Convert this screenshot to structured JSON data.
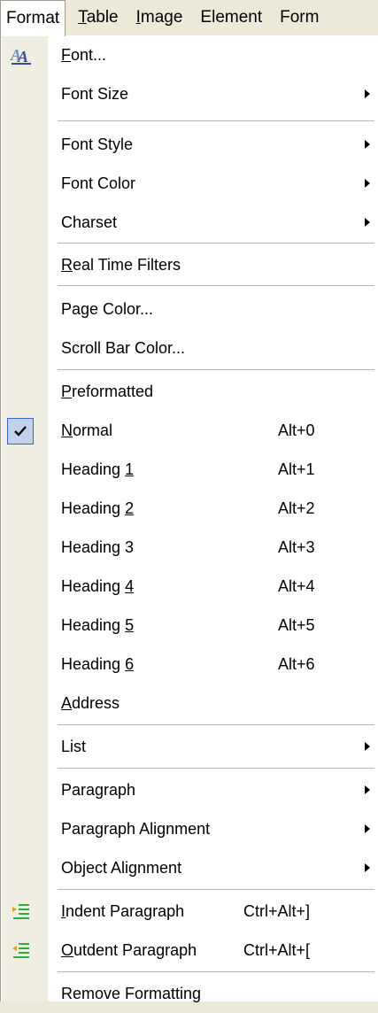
{
  "menubar": {
    "items": [
      {
        "label": "Format",
        "ul": ""
      },
      {
        "label": "able",
        "ul": "T"
      },
      {
        "label": "mage",
        "ul": "I"
      },
      {
        "label": "Element",
        "ul": ""
      },
      {
        "label": "Form",
        "ul": ""
      }
    ]
  },
  "menu": {
    "font": {
      "ul": "F",
      "rest": "ont..."
    },
    "font_size": "Font Size",
    "font_style": "Font Style",
    "font_color": "Font Color",
    "charset": "Charset",
    "real_time_filters": {
      "ul": "R",
      "rest": "eal Time Filters"
    },
    "page_color": "Page Color...",
    "scroll_bar_color": "Scroll Bar Color...",
    "preformatted": {
      "ul": "P",
      "rest": "reformatted"
    },
    "normal": {
      "ul": "N",
      "rest": "ormal",
      "shortcut": "Alt+0"
    },
    "heading1": {
      "pre": "Heading ",
      "ul": "1",
      "shortcut": "Alt+1"
    },
    "heading2": {
      "pre": "Heading ",
      "ul": "2",
      "shortcut": "Alt+2"
    },
    "heading3": {
      "label": "Heading 3",
      "shortcut": "Alt+3"
    },
    "heading4": {
      "pre": "Heading ",
      "ul": "4",
      "shortcut": "Alt+4"
    },
    "heading5": {
      "pre": "Heading ",
      "ul": "5",
      "shortcut": "Alt+5"
    },
    "heading6": {
      "pre": "Heading ",
      "ul": "6",
      "shortcut": "Alt+6"
    },
    "address": {
      "ul": "A",
      "rest": "ddress"
    },
    "list": "List",
    "paragraph": "Paragraph",
    "paragraph_alignment": "Paragraph Alignment",
    "object_alignment": "Object Alignment",
    "indent_paragraph": {
      "ul": "I",
      "rest": "ndent Paragraph",
      "shortcut": "Ctrl+Alt+]"
    },
    "outdent_paragraph": {
      "ul": "O",
      "rest": "utdent Paragraph",
      "shortcut": "Ctrl+Alt+["
    },
    "remove_formatting": "Remove Formatting"
  },
  "colors": {
    "gutter": "#f0ede2",
    "checked_bg": "#c1d2ee",
    "checked_border": "#316ac5",
    "indent_icon": "#2fae3c"
  }
}
